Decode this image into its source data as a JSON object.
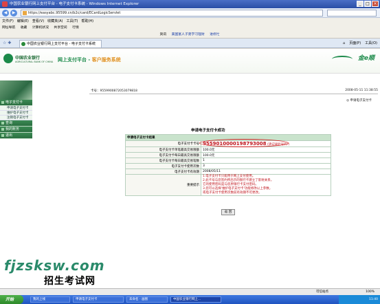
{
  "window": {
    "title": "中国农业银行网上支付平台 - 电子支付卡系统 - Windows Internet Explorer"
  },
  "address": {
    "url": "https://easyabc.95599.cn/b2c/card/ECardLogicServlet"
  },
  "menu": [
    "文件(F)",
    "编辑(E)",
    "查看(V)",
    "收藏夹(A)",
    "工具(T)",
    "帮助(H)"
  ],
  "toolbar1": [
    "网址导航",
    "收藏",
    "计算机状况",
    "共享空间",
    "行情"
  ],
  "toolbar2": {
    "links": [
      "资讯",
      "美国富人子弟学习理财",
      "进修忙"
    ]
  },
  "tab": {
    "label": "中国农业银行网上支付平台 - 电子支付卡系统"
  },
  "right_tools": [
    "页面(P)",
    "工具(O)"
  ],
  "header": {
    "bank_name": "中国农业银行",
    "bank_en": "AGRICULTURAL BANK OF CHINA",
    "title_main": "网上支付平台 - ",
    "title_service": "客户服务系统",
    "brand": "金e顺"
  },
  "sidebar": {
    "groups": [
      {
        "label": "电子支付卡",
        "items": [
          "申请电子支付卡",
          "维护电子支付卡",
          "注销电子支付卡"
        ]
      },
      {
        "label": "查询",
        "items": []
      },
      {
        "label": "我的账务",
        "items": []
      },
      {
        "label": "退出",
        "items": []
      }
    ]
  },
  "info": {
    "card_no": "卡号：95599008720530798​18",
    "datetime": "2008-05-11 11:38:55",
    "back_link": "申请电子支付卡"
  },
  "result": {
    "title": "申请电子支付卡成功",
    "table_header": "申请电子支付卡结果",
    "rows": [
      {
        "label": "电子支付卡卡号",
        "value": "9559010000198793008",
        "note": "(请记录此号码!)"
      },
      {
        "label": "电子支付卡单笔最高交易限额",
        "value": "100.0元"
      },
      {
        "label": "电子支付卡每日最高交易限额",
        "value": "100.0元"
      },
      {
        "label": "电子支付卡每日最高交易笔数",
        "value": "1"
      },
      {
        "label": "电子支付卡使用次数",
        "value": "3"
      },
      {
        "label": "电子支付卡有效期",
        "value": "2008/05/11"
      }
    ],
    "notice_label": "重要提示",
    "notices": [
      "1.电子支付卡只能用于网上支付使用。",
      "2.此卡号与您签约所出示的银行卡建立了影射关系，",
      "  它的使用密码是与您原银行卡支付密码。",
      "3.您可以选择'维护电子支付卡'功能修改以上参数，",
      "  或电子支付卡使用次数前有效期不可更改。"
    ],
    "return_label": "返 回"
  },
  "watermark": {
    "line1": "fjzsksw.com",
    "line2": "招生考试网"
  },
  "status": {
    "zone": "可信站点",
    "zoom": "100%"
  },
  "taskbar": {
    "start": "开始",
    "items": [
      "我的上线",
      "申请电子支付卡",
      "未命名 - 画图",
      "中国农业银行网上..."
    ],
    "clock": "11:40"
  }
}
